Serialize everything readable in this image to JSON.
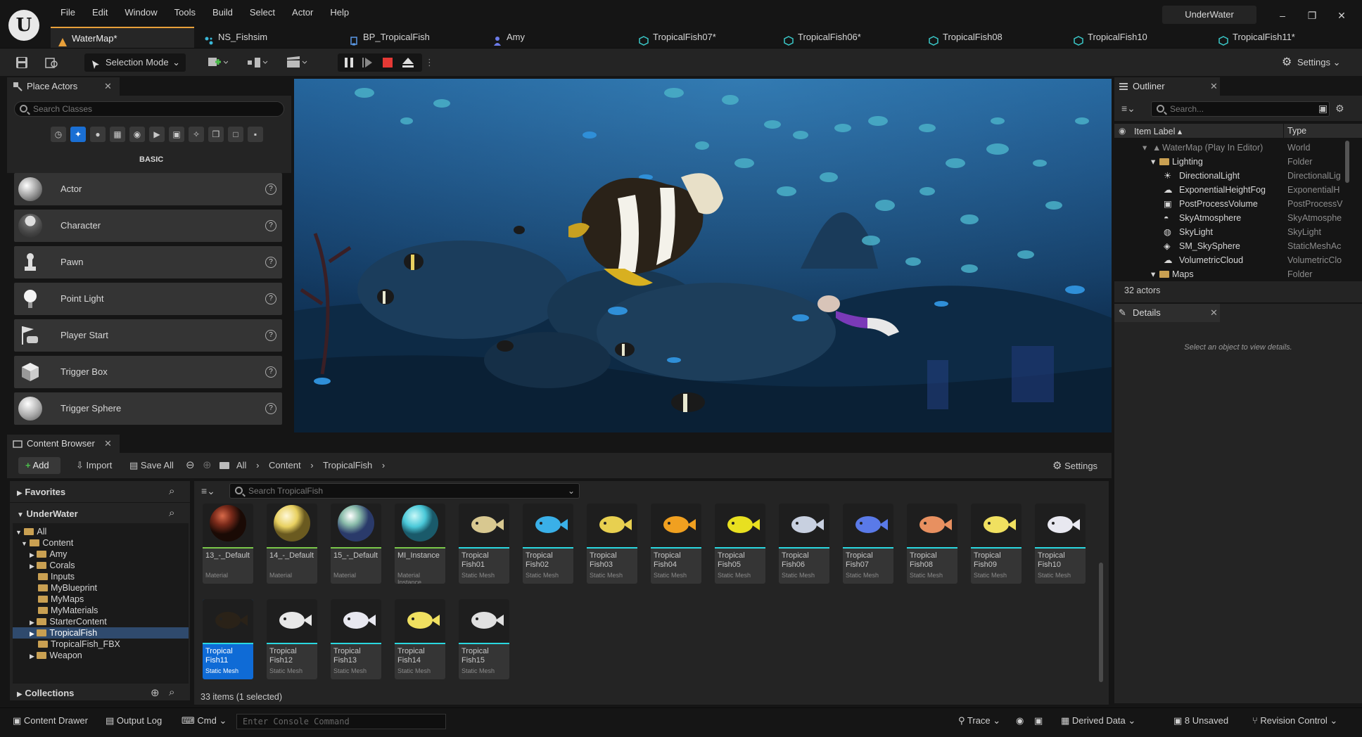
{
  "menu": [
    "File",
    "Edit",
    "Window",
    "Tools",
    "Build",
    "Select",
    "Actor",
    "Help"
  ],
  "project_name": "UnderWater",
  "tabs": [
    {
      "label": "WaterMap*",
      "icon": "level-icon"
    },
    {
      "label": "NS_Fishsim",
      "icon": "niagara-icon"
    },
    {
      "label": "BP_TropicalFish",
      "icon": "blueprint-icon"
    },
    {
      "label": "Amy",
      "icon": "skeleton-icon"
    },
    {
      "label": "TropicalFish07*",
      "icon": "mesh-icon"
    },
    {
      "label": "TropicalFish06*",
      "icon": "mesh-icon"
    },
    {
      "label": "TropicalFish08",
      "icon": "mesh-icon"
    },
    {
      "label": "TropicalFish10",
      "icon": "mesh-icon"
    },
    {
      "label": "TropicalFish11*",
      "icon": "mesh-icon"
    }
  ],
  "toolbar": {
    "selection_mode": "Selection Mode",
    "settings": "Settings"
  },
  "place_actors": {
    "title": "Place Actors",
    "search_placeholder": "Search Classes",
    "category": "BASIC",
    "items": [
      "Actor",
      "Character",
      "Pawn",
      "Point Light",
      "Player Start",
      "Trigger Box",
      "Trigger Sphere"
    ]
  },
  "outliner": {
    "title": "Outliner",
    "search_placeholder": "Search...",
    "col_label": "Item Label ▴",
    "col_type": "Type",
    "rows": [
      {
        "label": "WaterMap (Play In Editor)",
        "type": "World"
      },
      {
        "label": "Lighting",
        "type": "Folder"
      },
      {
        "label": "DirectionalLight",
        "type": "DirectionalLig"
      },
      {
        "label": "ExponentialHeightFog",
        "type": "ExponentialH"
      },
      {
        "label": "PostProcessVolume",
        "type": "PostProcessV"
      },
      {
        "label": "SkyAtmosphere",
        "type": "SkyAtmosphe"
      },
      {
        "label": "SkyLight",
        "type": "SkyLight"
      },
      {
        "label": "SM_SkySphere",
        "type": "StaticMeshAc"
      },
      {
        "label": "VolumetricCloud",
        "type": "VolumetricClo"
      },
      {
        "label": "Maps",
        "type": "Folder"
      }
    ],
    "count": "32 actors"
  },
  "details": {
    "title": "Details",
    "empty_msg": "Select an object to view details."
  },
  "content_browser": {
    "title": "Content Browser",
    "add": "Add",
    "import": "Import",
    "save_all": "Save All",
    "crumbs": [
      "All",
      "Content",
      "TropicalFish"
    ],
    "settings": "Settings",
    "favorites": "Favorites",
    "project": "UnderWater",
    "collections": "Collections",
    "search_placeholder": "Search TropicalFish",
    "tree": [
      "All",
      "Content",
      "Amy",
      "Corals",
      "Inputs",
      "MyBlueprint",
      "MyMaps",
      "MyMaterials",
      "StarterContent",
      "TropicalFish",
      "TropicalFish_FBX",
      "Weapon"
    ],
    "assets_row1": [
      {
        "name": "13_-_Default",
        "type": "Material"
      },
      {
        "name": "14_-_Default",
        "type": "Material"
      },
      {
        "name": "15_-_Default",
        "type": "Material"
      },
      {
        "name": "MI_Instance",
        "type": "Material Instance"
      },
      {
        "name": "Tropical Fish01",
        "type": "Static Mesh"
      },
      {
        "name": "Tropical Fish02",
        "type": "Static Mesh"
      },
      {
        "name": "Tropical Fish03",
        "type": "Static Mesh"
      },
      {
        "name": "Tropical Fish04",
        "type": "Static Mesh"
      },
      {
        "name": "Tropical Fish05",
        "type": "Static Mesh"
      },
      {
        "name": "Tropical Fish06",
        "type": "Static Mesh"
      },
      {
        "name": "Tropical Fish07",
        "type": "Static Mesh"
      },
      {
        "name": "Tropical Fish08",
        "type": "Static Mesh"
      },
      {
        "name": "Tropical Fish09",
        "type": "Static Mesh"
      },
      {
        "name": "Tropical Fish10",
        "type": "Static Mesh"
      }
    ],
    "assets_row2": [
      {
        "name": "Tropical Fish11",
        "type": "Static Mesh"
      },
      {
        "name": "Tropical Fish12",
        "type": "Static Mesh"
      },
      {
        "name": "Tropical Fish13",
        "type": "Static Mesh"
      },
      {
        "name": "Tropical Fish14",
        "type": "Static Mesh"
      },
      {
        "name": "Tropical Fish15",
        "type": "Static Mesh"
      }
    ],
    "status": "33 items (1 selected)"
  },
  "statusbar": {
    "content_drawer": "Content Drawer",
    "output_log": "Output Log",
    "cmd": "Cmd",
    "console_placeholder": "Enter Console Command",
    "trace": "Trace",
    "derived_data": "Derived Data",
    "unsaved": "8 Unsaved",
    "revision": "Revision Control"
  }
}
